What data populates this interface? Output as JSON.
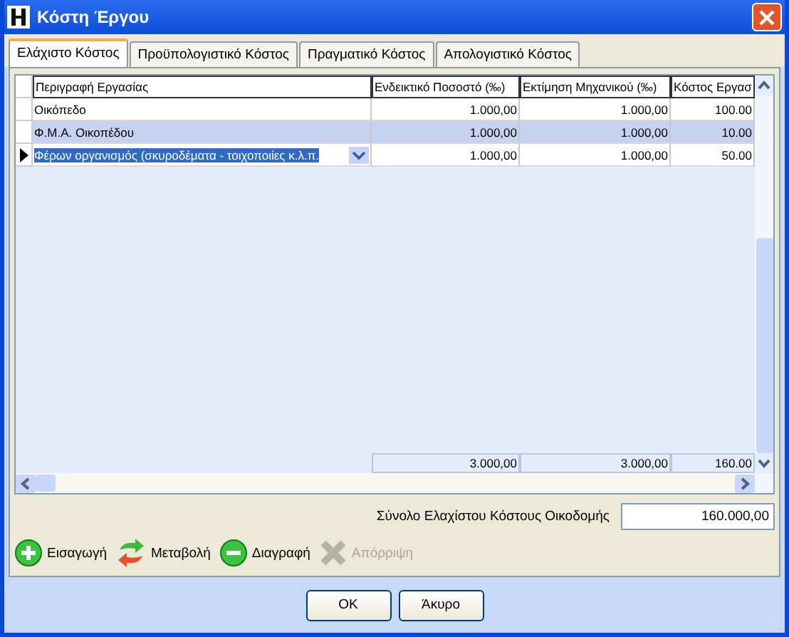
{
  "window": {
    "title": "Κόστη Έργου"
  },
  "tabs": [
    {
      "label": "Ελάχιστο Κόστος",
      "selected": true
    },
    {
      "label": "Προϋπολογιστικό Κόστος",
      "selected": false
    },
    {
      "label": "Πραγματικό Κόστος",
      "selected": false
    },
    {
      "label": "Απολογιστικό Κόστος",
      "selected": false
    }
  ],
  "table": {
    "columns": [
      "Περιγραφή Εργασίας",
      "Ενδεικτικό Ποσοστό (‰)",
      "Εκτίμηση Μηχανικού (‰)",
      "Κόστος Εργασ"
    ],
    "rows": [
      {
        "cells": [
          "Οικόπεδο",
          "1.000,00",
          "1.000,00",
          "100.00"
        ],
        "current": false,
        "highlighted": false
      },
      {
        "cells": [
          "Φ.Μ.Α. Οικοπέδου",
          "1.000,00",
          "1.000,00",
          "10.00"
        ],
        "current": false,
        "highlighted": true
      },
      {
        "cells": [
          "Φέρων οργανισμός (σκυροδέματα - τοιχοποιίες κ.λ.π.",
          "1.000,00",
          "1.000,00",
          "50.00"
        ],
        "current": true,
        "highlighted": false
      }
    ],
    "totals": [
      "3.000,00",
      "3.000,00",
      "160.00"
    ]
  },
  "total_field": {
    "label": "Σύνολο Ελαχίστου Κόστους Οικοδομής",
    "value": "160.000,00"
  },
  "actions": [
    {
      "label": "Εισαγωγή",
      "kind": "add",
      "disabled": false
    },
    {
      "label": "Μεταβολή",
      "kind": "change",
      "disabled": false
    },
    {
      "label": "Διαγραφή",
      "kind": "delete",
      "disabled": false
    },
    {
      "label": "Απόρριψη",
      "kind": "reject",
      "disabled": true
    }
  ],
  "buttons": [
    "OK",
    "Άκυρο"
  ]
}
